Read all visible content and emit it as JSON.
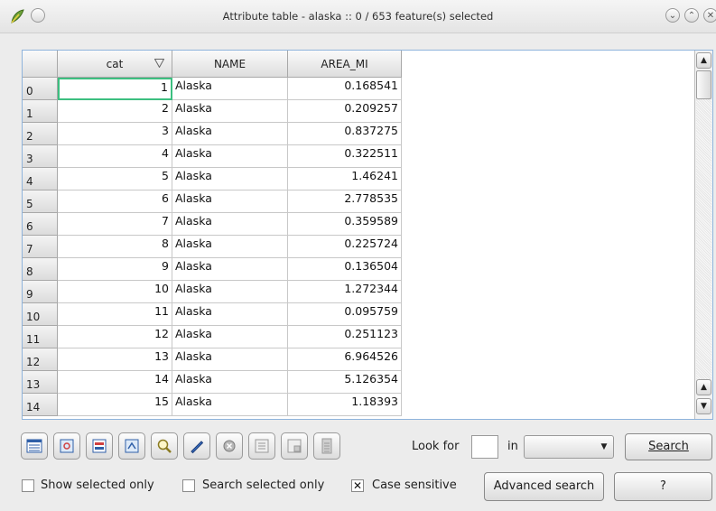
{
  "window": {
    "title": "Attribute table - alaska :: 0 / 653 feature(s) selected",
    "icons": {
      "app": "qgis-leaf-icon",
      "menu": "window-menu-icon",
      "minimize": "minimize-icon",
      "maximize": "maximize-icon",
      "close": "close-icon"
    }
  },
  "table": {
    "columns": [
      "cat",
      "NAME",
      "AREA_MI"
    ],
    "sort_icon": "sort-descending-icon",
    "rows": [
      {
        "index": "0",
        "cat": "1",
        "name": "Alaska",
        "area": "0.168541"
      },
      {
        "index": "1",
        "cat": "2",
        "name": "Alaska",
        "area": "0.209257"
      },
      {
        "index": "2",
        "cat": "3",
        "name": "Alaska",
        "area": "0.837275"
      },
      {
        "index": "3",
        "cat": "4",
        "name": "Alaska",
        "area": "0.322511"
      },
      {
        "index": "4",
        "cat": "5",
        "name": "Alaska",
        "area": "1.46241"
      },
      {
        "index": "5",
        "cat": "6",
        "name": "Alaska",
        "area": "2.778535"
      },
      {
        "index": "6",
        "cat": "7",
        "name": "Alaska",
        "area": "0.359589"
      },
      {
        "index": "7",
        "cat": "8",
        "name": "Alaska",
        "area": "0.225724"
      },
      {
        "index": "8",
        "cat": "9",
        "name": "Alaska",
        "area": "0.136504"
      },
      {
        "index": "9",
        "cat": "10",
        "name": "Alaska",
        "area": "1.272344"
      },
      {
        "index": "10",
        "cat": "11",
        "name": "Alaska",
        "area": "0.095759"
      },
      {
        "index": "11",
        "cat": "12",
        "name": "Alaska",
        "area": "0.251123"
      },
      {
        "index": "12",
        "cat": "13",
        "name": "Alaska",
        "area": "6.964526"
      },
      {
        "index": "13",
        "cat": "14",
        "name": "Alaska",
        "area": "5.126354"
      },
      {
        "index": "14",
        "cat": "15",
        "name": "Alaska",
        "area": "1.18393"
      }
    ]
  },
  "toolbar": {
    "buttons": [
      "table-view-icon",
      "zoom-to-selection-icon",
      "invert-selection-icon",
      "move-to-top-icon",
      "search-magnifier-icon",
      "edit-pencil-icon",
      "delete-icon",
      "new-column-icon",
      "open-field-calculator-icon",
      "calculator-icon"
    ],
    "lookfor_label": "Look for",
    "lookfor_value": "",
    "in_label": "in",
    "field_select_value": "",
    "search_label": "Search"
  },
  "options": {
    "show_selected_only": {
      "label": "Show selected only",
      "checked": false
    },
    "search_selected_only": {
      "label": "Search selected only",
      "checked": false
    },
    "case_sensitive": {
      "label": "Case sensitive",
      "checked": true
    },
    "advanced_search_label": "Advanced search",
    "help_label": "?"
  },
  "colors": {
    "accent_border": "#8fb4dc",
    "focus_cell": "#3cbf80"
  }
}
